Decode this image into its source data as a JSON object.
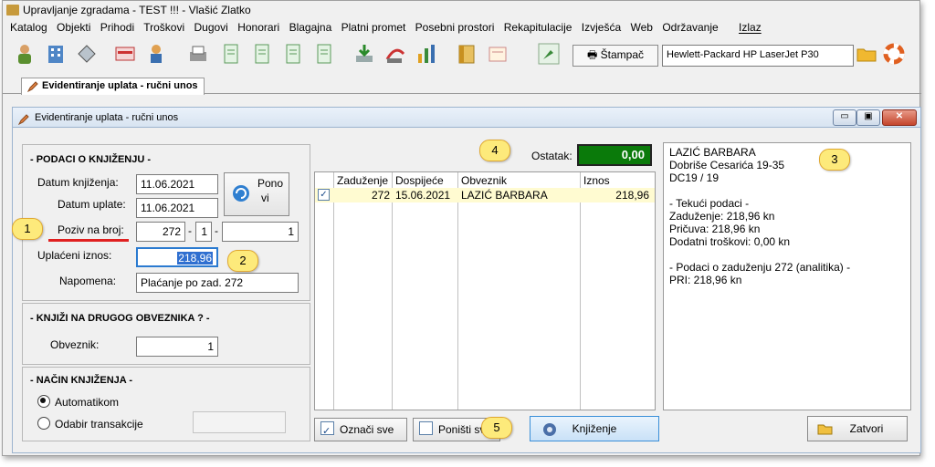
{
  "window": {
    "title": "Upravljanje zgradama - TEST !!! - Vlašić Zlatko"
  },
  "menu": [
    "Katalog",
    "Objekti",
    "Prihodi",
    "Troškovi",
    "Dugovi",
    "Honorari",
    "Blagajna",
    "Platni promet",
    "Posebni prostori",
    "Rekapitulacije",
    "Izvješća",
    "Web",
    "Održavanje"
  ],
  "menu_exit": "Izlaz",
  "toolbar": {
    "stampac_label": "Štampač",
    "printer_name": "Hewlett-Packard HP LaserJet P30"
  },
  "tab": {
    "label": "Evidentiranje uplata - ručni unos"
  },
  "form": {
    "title": "Evidentiranje uplata - ručni unos"
  },
  "podaci": {
    "header": "- PODACI O KNJIŽENJU -",
    "datum_knjizenja_label": "Datum knjiženja:",
    "datum_knjizenja": "11.06.2021",
    "datum_uplate_label": "Datum uplate:",
    "datum_uplate": "11.06.2021",
    "ponovi_line1": "Pono",
    "ponovi_line2": "vi",
    "poziv_label": "Poziv na broj:",
    "poziv_1": "272",
    "poziv_2": "1",
    "poziv_3": "1",
    "poziv_sep": "-",
    "uplaceni_label": "Uplaćeni iznos:",
    "uplaceni_iznos": "218,96",
    "napomena_label": "Napomena:",
    "napomena": "Plaćanje po zad. 272"
  },
  "drugi": {
    "header": "- KNJIŽI NA DRUGOG OBVEZNIKA ? -",
    "obveznik_label": "Obveznik:",
    "obveznik": "1"
  },
  "nacin": {
    "header": "- NAČIN KNJIŽENJA -",
    "auto": "Automatikom",
    "odabir": "Odabir transakcije"
  },
  "ostatak": {
    "label": "Ostatak:",
    "value": "0,00"
  },
  "table": {
    "headers": [
      "Zaduženje",
      "Dospijeće",
      "Obveznik",
      "Iznos"
    ],
    "rows": [
      {
        "zaduzenje": "272",
        "dospijece": "15.06.2021",
        "obveznik": "LAZIĆ BARBARA",
        "iznos": "218,96",
        "checked": true
      }
    ]
  },
  "info": {
    "lines": [
      "LAZIĆ BARBARA",
      "Dobriše Cesarića 19-35",
      "DC19 / 19",
      "",
      "- Tekući podaci -",
      "Zaduženje: 218,96 kn",
      "Pričuva: 218,96 kn",
      "Dodatni troškovi: 0,00 kn",
      "",
      "- Podaci o zaduženju 272 (analitika) -",
      "PRI: 218,96 kn"
    ]
  },
  "buttons": {
    "oznaci_sve": "Označi sve",
    "ponisti_sve": "Poništi sve",
    "knjizenje": "Knjiženje",
    "zatvori": "Zatvori"
  },
  "callouts": {
    "c1": "1",
    "c2": "2",
    "c3": "3",
    "c4": "4",
    "c5": "5"
  },
  "colors": {
    "ostatak_bg": "#0a7a0a",
    "selected_row": "#fffbd1",
    "callout": "#fdea7b",
    "underline": "#e02020"
  }
}
